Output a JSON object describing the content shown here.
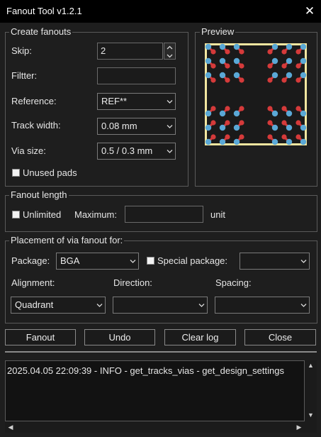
{
  "window": {
    "title": "Fanout Tool v1.2.1",
    "close_glyph": "✕"
  },
  "create_fanouts": {
    "legend": "Create fanouts",
    "skip_label": "Skip:",
    "skip_value": "2",
    "filter_label": "Filtter:",
    "filter_value": "",
    "reference_label": "Reference:",
    "reference_value": "REF**",
    "track_width_label": "Track width:",
    "track_width_value": "0.08 mm",
    "via_size_label": "Via size:",
    "via_size_value": "0.5 / 0.3 mm",
    "unused_pads_label": "Unused pads",
    "unused_pads_checked": false
  },
  "preview": {
    "legend": "Preview",
    "colors": {
      "frame": "#f2e6a0",
      "background": "#1a1a1a",
      "via": "#5aa8d6",
      "pad": "#d53a3a",
      "trace": "#d53a3a"
    }
  },
  "fanout_length": {
    "legend": "Fanout length",
    "unlimited_label": "Unlimited",
    "unlimited_checked": false,
    "maximum_label": "Maximum:",
    "maximum_value": "",
    "unit_label": "unit"
  },
  "placement": {
    "legend": "Placement of via fanout for:",
    "package_label": "Package:",
    "package_value": "BGA",
    "special_package_label": "Special package:",
    "special_package_checked": false,
    "special_package_value": "",
    "alignment_label": "Alignment:",
    "alignment_value": "Quadrant",
    "direction_label": "Direction:",
    "direction_value": "",
    "spacing_label": "Spacing:",
    "spacing_value": ""
  },
  "buttons": {
    "fanout": "Fanout",
    "undo": "Undo",
    "clear_log": "Clear log",
    "close": "Close"
  },
  "log": {
    "lines": [
      "2025.04.05 22:09:39 - INFO - get_tracks_vias -  get_design_settings"
    ]
  },
  "scroll_glyphs": {
    "up": "▲",
    "down": "▼",
    "left": "◀",
    "right": "▶"
  }
}
